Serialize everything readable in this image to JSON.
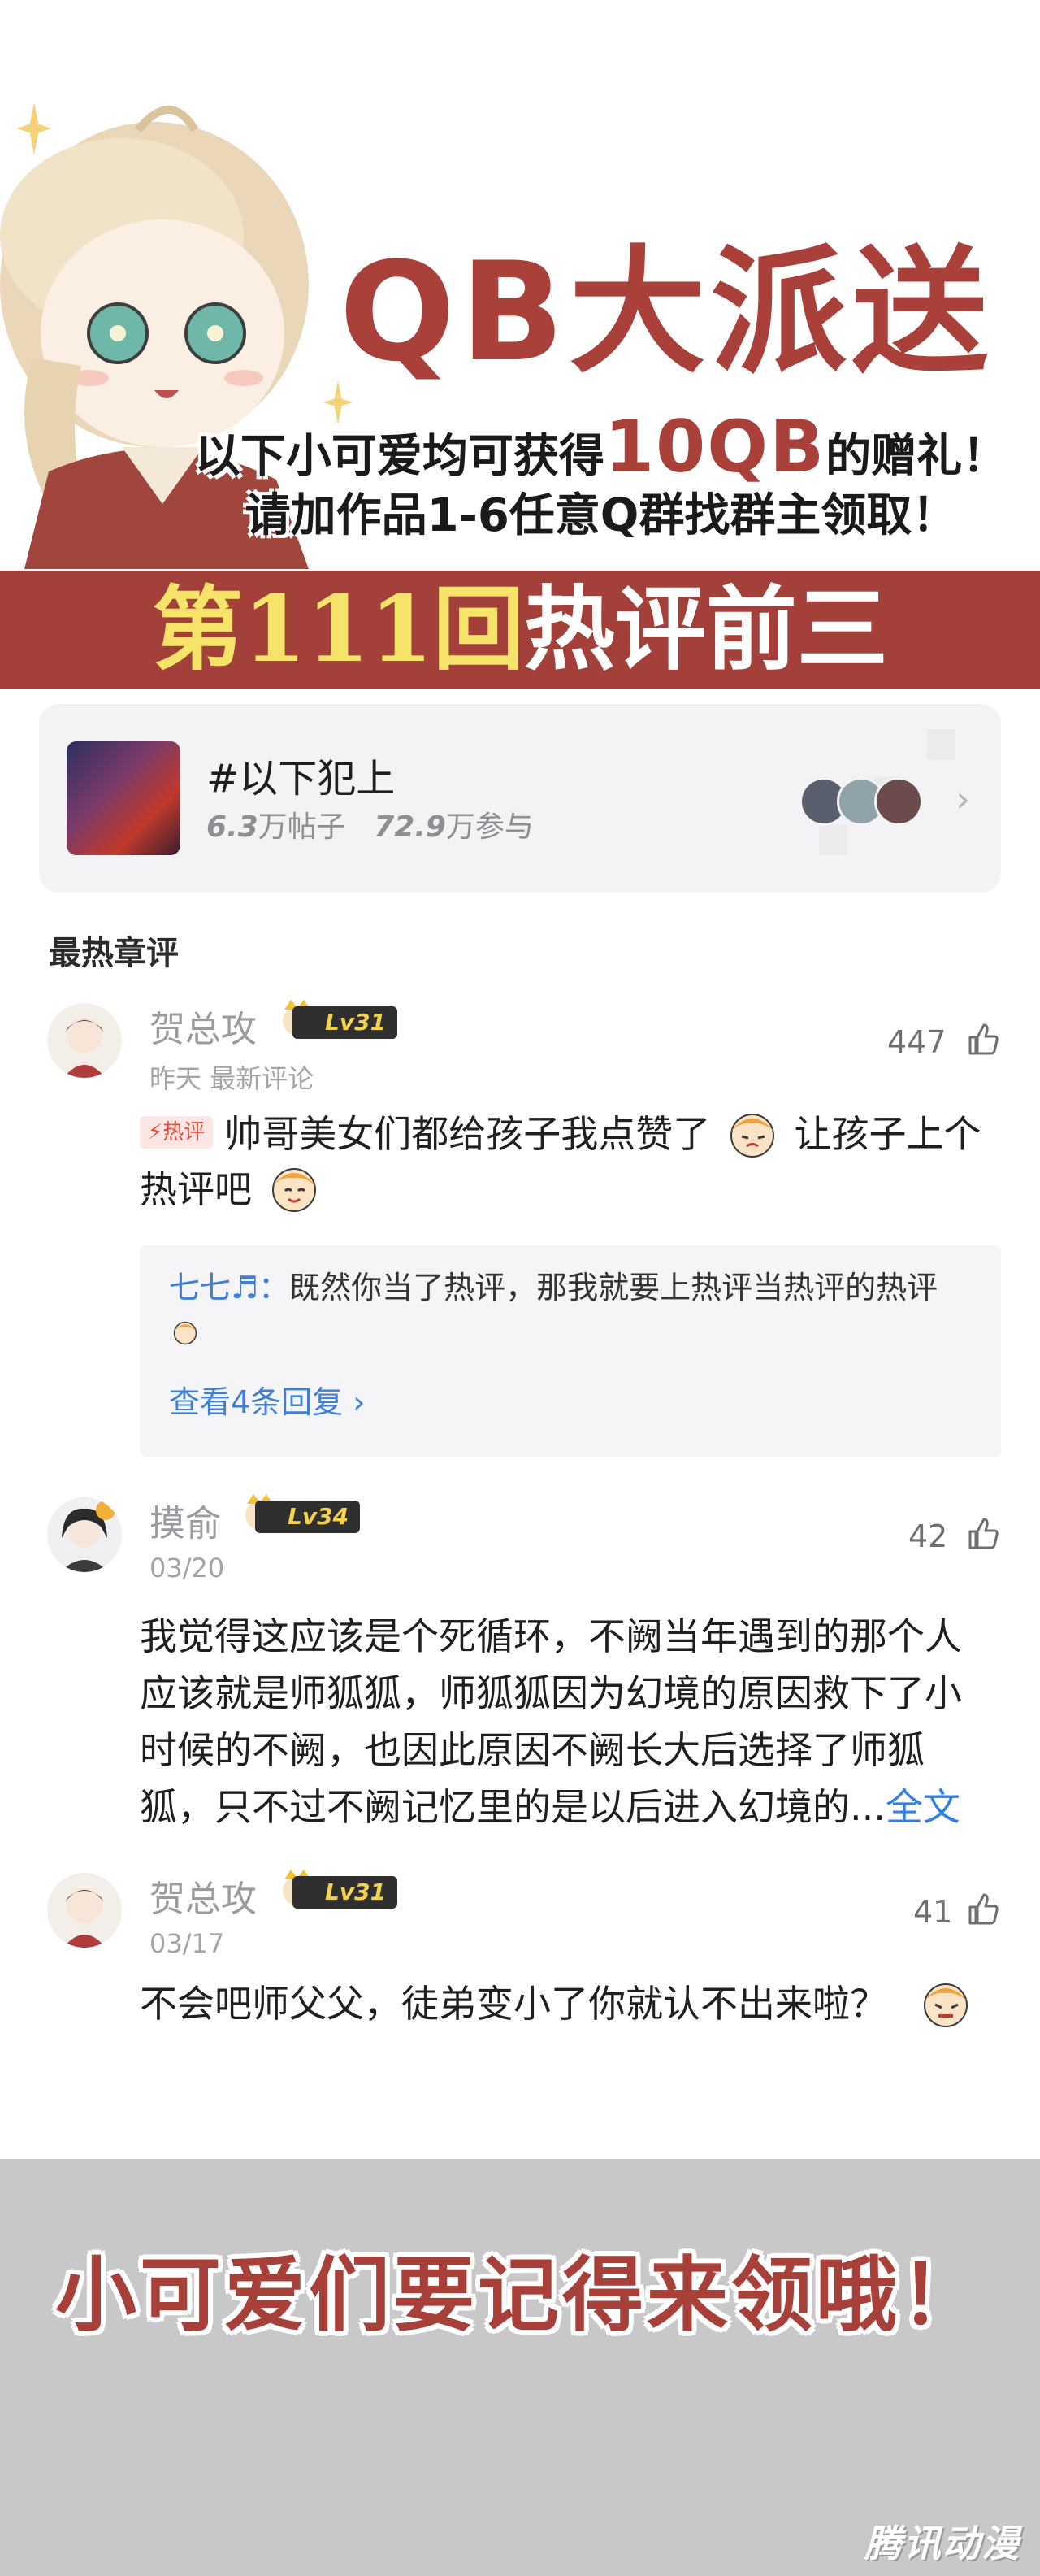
{
  "banner": {
    "title": "QB大派送",
    "line1_prefix": "以下小可爱均可获得",
    "line1_amount": "10QB",
    "line1_suffix": "的赠礼！",
    "line2": "请加作品1-6任意Q群找群主领取！",
    "ribbon_highlight": "第111回",
    "ribbon_rest": "热评前三"
  },
  "topic": {
    "title": "#以下犯上",
    "posts_value": "6.3",
    "posts_unit": "万帖子",
    "participants_value": "72.9",
    "participants_unit": "万参与",
    "chevron_icon": "chevron-right-icon"
  },
  "section": {
    "header": "最热章评"
  },
  "comments": [
    {
      "username": "贺总攻",
      "level": "Lv31",
      "meta": "昨天 最新评论",
      "likes": "447",
      "hot_tag": "热评",
      "text_part1": "帅哥美女们都给孩子我点赞了",
      "text_part2": "让孩子上个热评吧",
      "reply": {
        "author": "七七♬：",
        "text": "既然你当了热评，那我就要上热评当热评的热评",
        "view_replies": "查看4条回复 ›"
      }
    },
    {
      "username": "摸俞",
      "level": "Lv34",
      "meta": "03/20",
      "likes": "42",
      "text": "我觉得这应该是个死循环，不阙当年遇到的那个人应该就是师狐狐，师狐狐因为幻境的原因救下了小时候的不阙，也因此原因不阙长大后选择了师狐狐，只不过不阙记忆里的是以后进入幻境的...",
      "read_more": "全文"
    },
    {
      "username": "贺总攻",
      "level": "Lv31",
      "meta": "03/17",
      "likes": "41",
      "text": "不会吧师父父，徒弟变小了你就认不出来啦？"
    }
  ],
  "footer": {
    "text": "小可爱们要记得来领哦！",
    "logo": "腾讯动漫"
  },
  "colors": {
    "brand_red": "#a9403a",
    "ribbon_yellow": "#f5e36a",
    "link_blue": "#2f7fe6",
    "level_gold": "#f4d24e"
  }
}
